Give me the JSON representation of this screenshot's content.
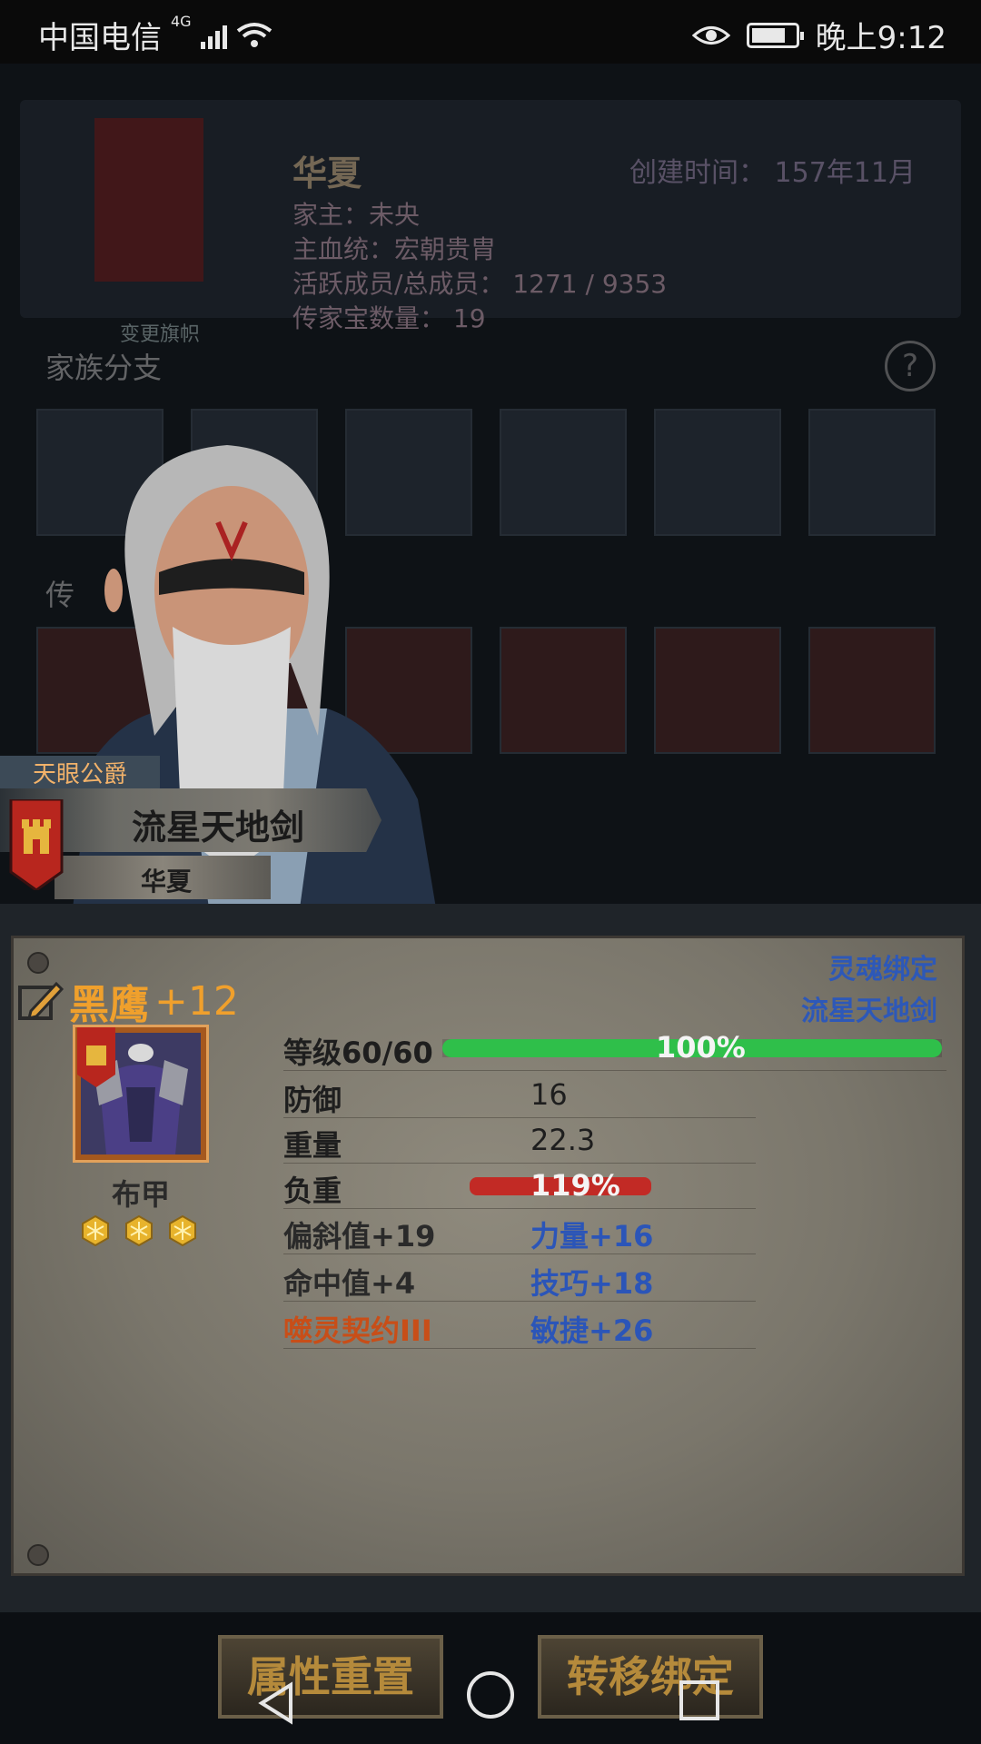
{
  "status_bar": {
    "carrier": "中国电信",
    "network": "4G",
    "time": "晚上9:12"
  },
  "family": {
    "name": "华夏",
    "change_banner": "变更旗帜",
    "created": "创建时间：  157年11月",
    "head": "家主：未央",
    "bloodline": "主血统：宏朝贵胄",
    "members": "活跃成员/总成员：  1271 / 9353",
    "heirlooms": "传家宝数量：  19",
    "branch_title": "家族分支",
    "heirloom_section_title": "传"
  },
  "character": {
    "title": "天眼公爵",
    "name": "流星天地剑",
    "family": "华夏"
  },
  "item": {
    "name": "黑鹰",
    "enhance": "+12",
    "type": "布甲",
    "stars": 3,
    "soul_bind_label": "灵魂绑定",
    "soul_bind_owner": "流星天地剑",
    "level_label": "等级60/60",
    "level_pct_text": "100%",
    "level_fill": 1.0,
    "stats": [
      {
        "label": "防御",
        "value": "16"
      },
      {
        "label": "重量",
        "value": "22.3"
      },
      {
        "label": "负重",
        "value": "119%"
      }
    ],
    "load_fill": 1.19,
    "bonuses": [
      {
        "left": "偏斜值+19",
        "right": "力量+16"
      },
      {
        "left": "命中值+4",
        "right": "技巧+18"
      },
      {
        "left": "噬灵契约III",
        "right": "敏捷+26"
      }
    ]
  },
  "buttons": {
    "reset": "属性重置",
    "transfer": "转移绑定"
  },
  "colors": {
    "item_name": "#f0a02c",
    "soul_bind": "#2d58b8",
    "level_bar": "#2fbf4a",
    "load_bar": "#c22a25",
    "special_bonus": "#c84e18"
  }
}
